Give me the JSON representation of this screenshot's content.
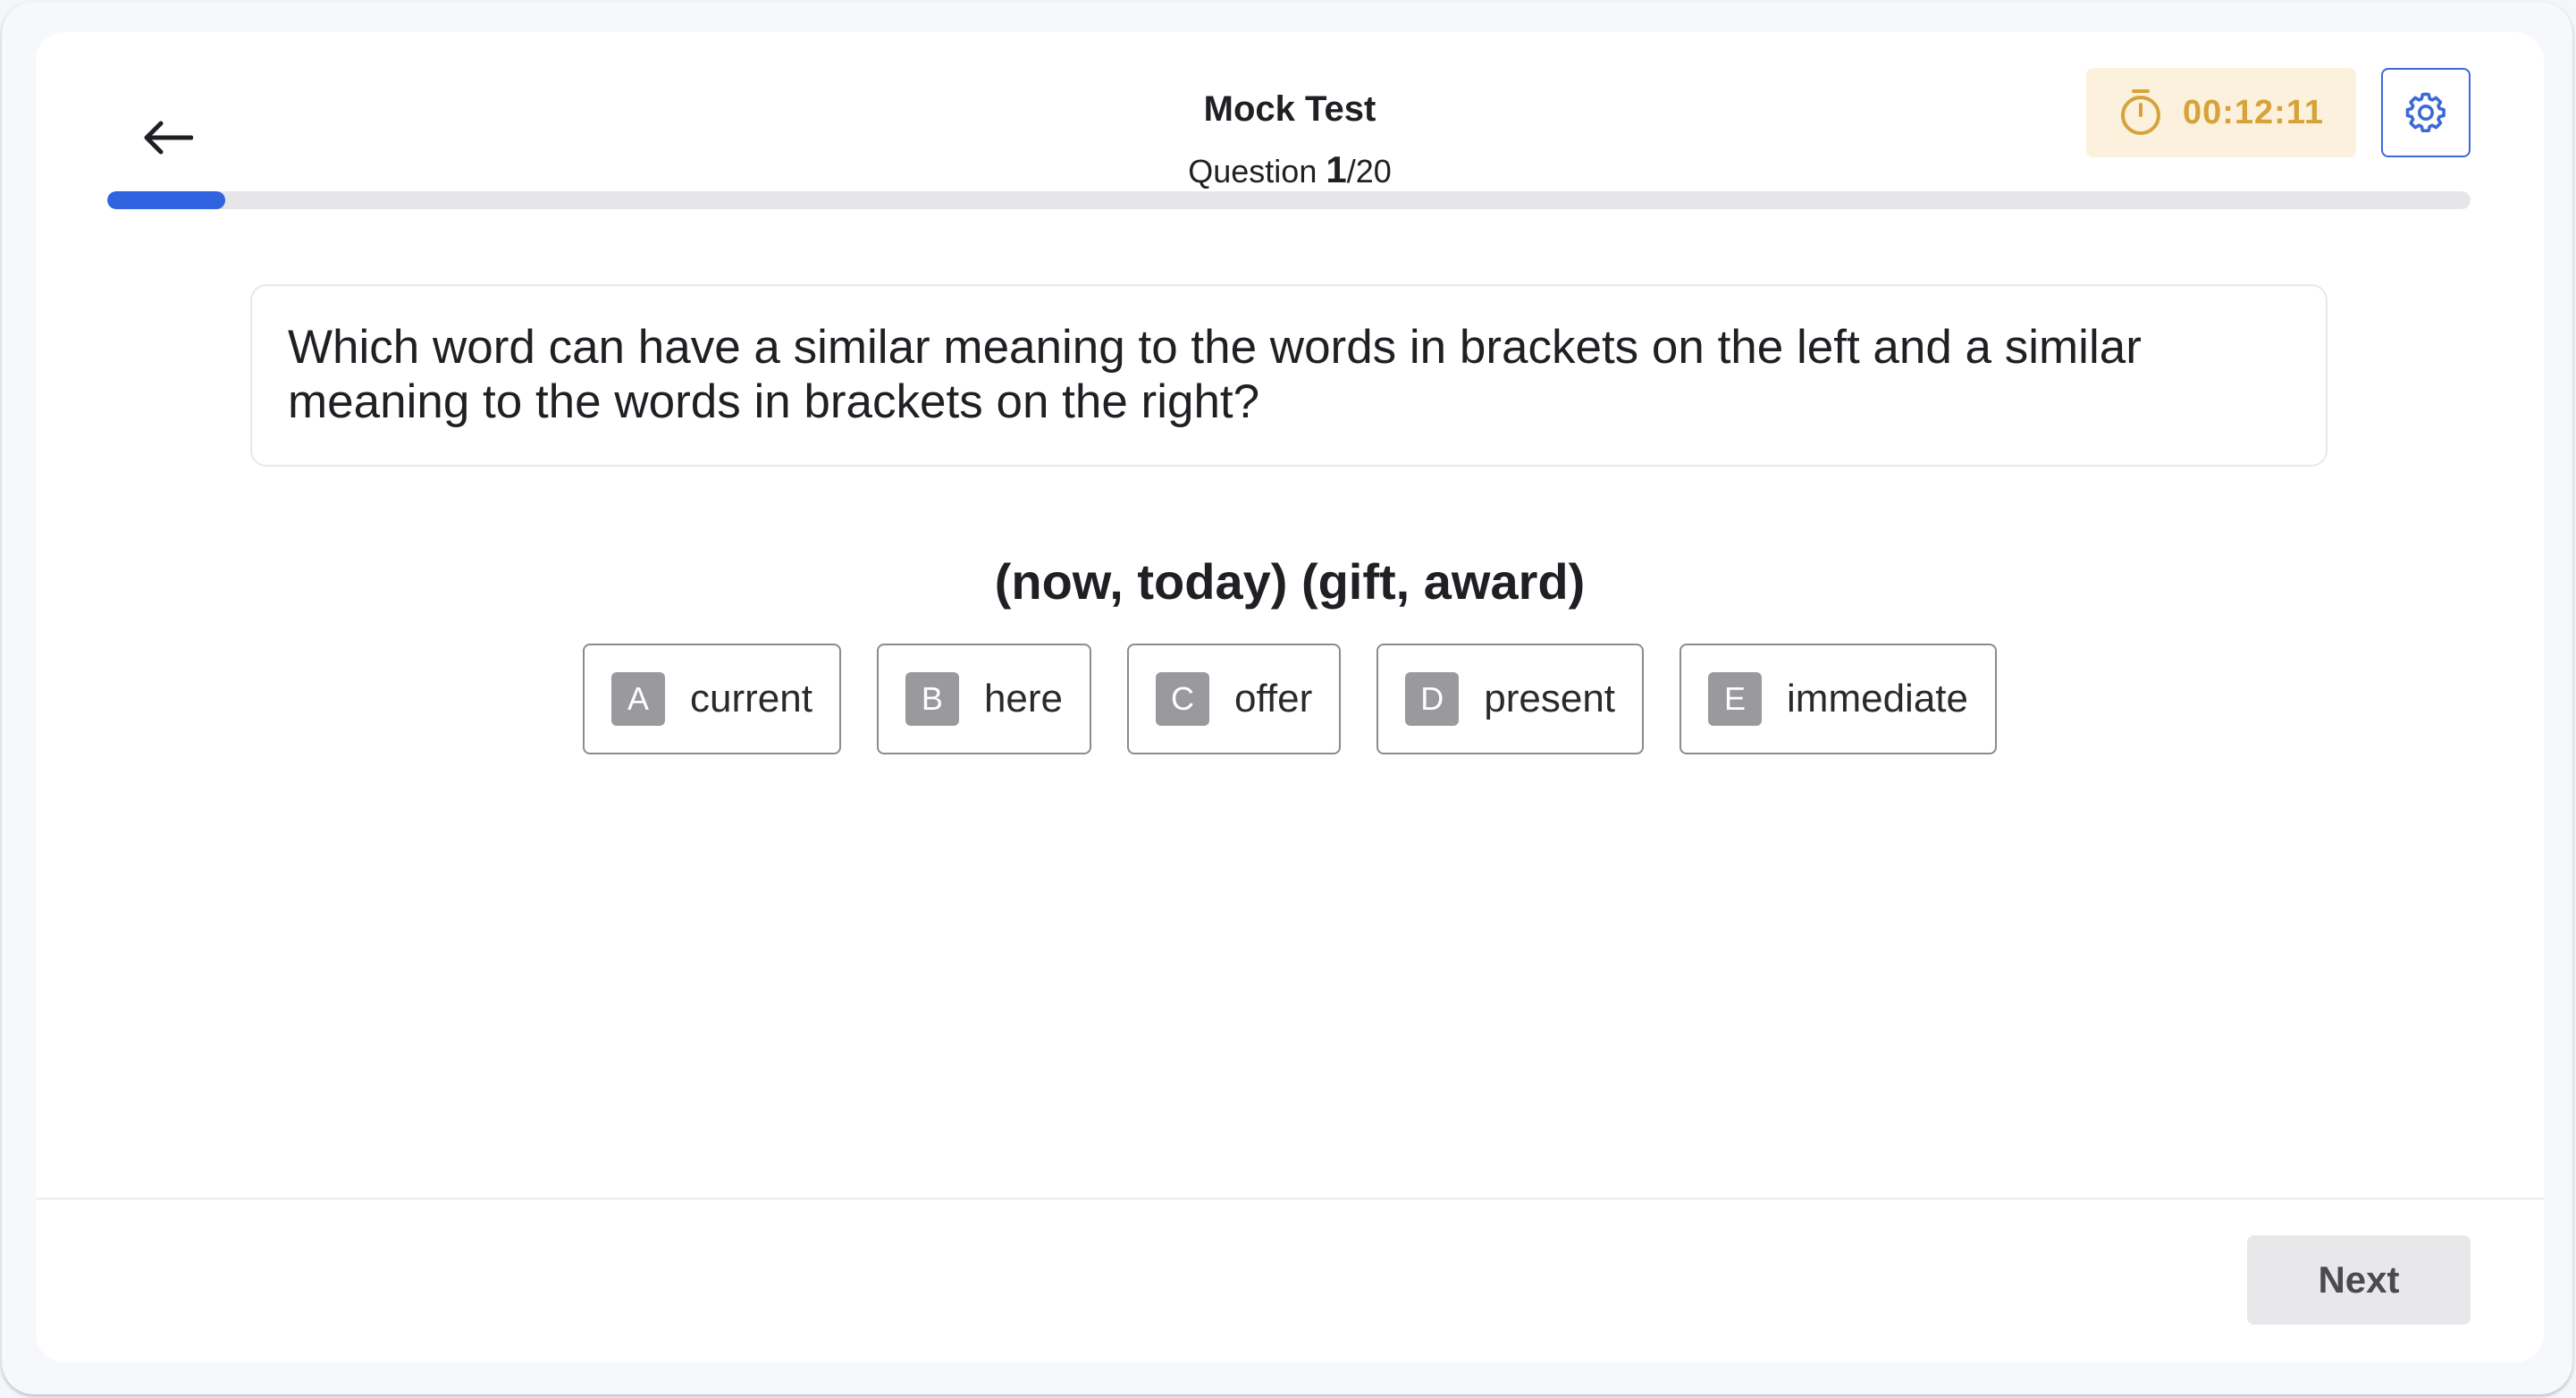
{
  "header": {
    "title": "Mock Test",
    "question_label": "Question ",
    "current_question": "1",
    "total_suffix": "/20",
    "progress_fraction": 0.05
  },
  "timer": {
    "value": "00:12:11",
    "icon": "stopwatch-icon"
  },
  "settings": {
    "icon": "gear-icon"
  },
  "back": {
    "icon": "arrow-left-icon"
  },
  "question": {
    "text": "Which word can have a similar meaning to the words in brackets on the left and a similar meaning to the words in brackets on the right?",
    "words": "(now, today) (gift, award)"
  },
  "options": [
    {
      "letter": "A",
      "text": "current"
    },
    {
      "letter": "B",
      "text": "here"
    },
    {
      "letter": "C",
      "text": "offer"
    },
    {
      "letter": "D",
      "text": "present"
    },
    {
      "letter": "E",
      "text": "immediate"
    }
  ],
  "footer": {
    "next_label": "Next"
  },
  "colors": {
    "accent": "#2f63e0",
    "timer_bg": "#fcf1dc",
    "timer_text": "#d6a33a",
    "option_letter_bg": "#9a9a9e"
  }
}
